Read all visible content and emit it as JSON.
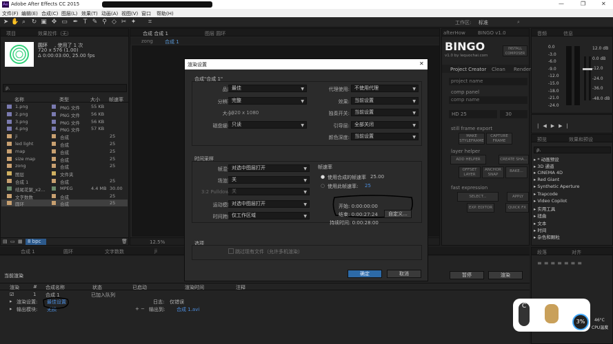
{
  "titlebar": {
    "app_title": "Adobe After Effects CC 2015",
    "logo": "Ae"
  },
  "menu": [
    "文件(F)",
    "编辑(E)",
    "合成(C)",
    "图层(L)",
    "效果(T)",
    "动画(A)",
    "视图(V)",
    "窗口",
    "帮助(H)"
  ],
  "toolbar": {
    "workspace_label": "工作区:",
    "workspace_value": "标准"
  },
  "project": {
    "tabs": [
      "项目",
      "效果控件（无）"
    ],
    "selected_name": "圆环",
    "selected_used": ", 使用了 1 次",
    "dims": "720 x 576 (1.00)",
    "duration": "Δ 0:00:03:00, 25.00 fps",
    "search_placeholder": "ρ.",
    "headers": {
      "name": "名称",
      "type": "类型",
      "size": "大小",
      "fps": "帧速率"
    },
    "items": [
      {
        "name": "1.png",
        "type": "PNG 文件",
        "size": "55 KB",
        "fps": ""
      },
      {
        "name": "2.png",
        "type": "PNG 文件",
        "size": "56 KB",
        "fps": ""
      },
      {
        "name": "3.png",
        "type": "PNG 文件",
        "size": "56 KB",
        "fps": ""
      },
      {
        "name": "4.png",
        "type": "PNG 文件",
        "size": "57 KB",
        "fps": ""
      },
      {
        "name": "ji",
        "type": "合成",
        "size": "",
        "fps": "25"
      },
      {
        "name": "led light",
        "type": "合成",
        "size": "",
        "fps": "25"
      },
      {
        "name": "map",
        "type": "合成",
        "size": "",
        "fps": "25"
      },
      {
        "name": "size map",
        "type": "合成",
        "size": "",
        "fps": "25"
      },
      {
        "name": "zong",
        "type": "合成",
        "size": "",
        "fps": "25"
      },
      {
        "name": "图层",
        "type": "文件夹",
        "size": "",
        "fps": ""
      },
      {
        "name": "合成 1",
        "type": "合成",
        "size": "",
        "fps": "25"
      },
      {
        "name": "结尾花絮_x2...",
        "type": "MPEG",
        "size": "4.4 MB",
        "fps": "30.00"
      },
      {
        "name": "文字数数",
        "type": "合成",
        "size": "",
        "fps": "25"
      },
      {
        "name": "圆环",
        "type": "合成",
        "size": "",
        "fps": "25"
      }
    ],
    "bpc": "8 bpc"
  },
  "comp": {
    "tabs": [
      "合成 合成 1",
      "图层 圆环"
    ],
    "crumbs": [
      "zong",
      "合成 1"
    ],
    "zoom": "12.5%"
  },
  "dialog": {
    "title": "渲染设置",
    "comp_label": "合成\"合成 1\"",
    "left": [
      {
        "label": "品质:",
        "value": "最佳"
      },
      {
        "label": "分辨率:",
        "value": "完整"
      },
      {
        "label": "大小:",
        "value": "1920 x 1080"
      },
      {
        "label": "磁盘缓存:",
        "value": "只读"
      }
    ],
    "right": [
      {
        "label": "代理使用:",
        "value": "不使用代理"
      },
      {
        "label": "效果:",
        "value": "当前设置"
      },
      {
        "label": "独奏开关:",
        "value": "当前设置"
      },
      {
        "label": "引导层:",
        "value": "全部关闭"
      },
      {
        "label": "颜色深度:",
        "value": "当前设置"
      }
    ],
    "time_title": "时间采样",
    "time": [
      {
        "label": "帧混合:",
        "value": "对选中图层打开"
      },
      {
        "label": "场渲染:",
        "value": "关"
      },
      {
        "label": "3:2 Pulldown:",
        "value": "关"
      },
      {
        "label": "运动模糊:",
        "value": "对选中图层打开"
      },
      {
        "label": "时间跨度:",
        "value": "仅工作区域"
      }
    ],
    "framerate_title": "帧速率",
    "fr_comp": "使用合成的帧速率",
    "fr_comp_value": "25.00",
    "fr_this": "使用此帧速率:",
    "fr_this_value": "25",
    "start": "开始: 0:00:00:00",
    "end": "结束: 0:00:27:24",
    "custom": "自定义...",
    "duration": "持续时间: 0:00:28:00",
    "options_title": "选项",
    "skip_label": "跳过现有文件（允许多机渲染）",
    "ok": "确定",
    "cancel": "取消"
  },
  "bingo": {
    "tab1": "afterHow",
    "tab2": "BINGO v1.0",
    "title": "BINGO",
    "version": "v1.0 by lequochai.com",
    "install": "INSTALL COMPOSER",
    "subtabs": [
      "Project Creator",
      "Clean",
      "Render"
    ],
    "project_name": "project name",
    "comp_panel": "comp panel",
    "comp_name": "comp name",
    "hd": "HD 25",
    "dur": "30",
    "sf_export": "still frame export",
    "make": "MAKE STYLEFRAME",
    "capture": "CAPTURE FRAME",
    "layer_helper": "layer helper",
    "add_helper": "ADD HELPER",
    "create_shape": "CREATE SHA...",
    "offset": "OFFSET LAYER",
    "anchor": "ANCHOR SNAP",
    "bake": "BAKE...",
    "fast_expr": "fast expression",
    "select": "SELECT...",
    "apply": "APPLY",
    "exp_editor": "EXP. EDITOR",
    "quick": "QUICK FX"
  },
  "audio": {
    "tabs": [
      "音频",
      "信息"
    ],
    "db_left": [
      "0.0",
      "-3.0",
      "-6.0",
      "-9.0",
      "-12.0",
      "-15.0",
      "-18.0",
      "-21.0",
      "-24.0"
    ],
    "db_right": [
      "12.0 dB",
      "0.0 dB",
      "-12.0",
      "-24.0",
      "-36.0",
      "-48.0 dB"
    ]
  },
  "preview": {
    "tabs": [
      "预览",
      "效果和预设"
    ]
  },
  "effects": {
    "search": "ρ.",
    "items": [
      "* 动画预设",
      "3D 通道",
      "CINEMA 4D",
      "Red Giant",
      "Synthetic Aperture",
      "Trapcode",
      "Video Copilot",
      "实用工具",
      "扭曲",
      "文本",
      "时间",
      "杂色和颗粒"
    ]
  },
  "paragraph": {
    "tabs": [
      "段落",
      "对齐"
    ]
  },
  "timeline": {
    "tabs": [
      "合成 1",
      "圆环",
      "文字数数",
      "ji"
    ]
  },
  "render_queue": {
    "title": "当前渲染",
    "headers": [
      "渲染",
      "#",
      "合成名称",
      "状态",
      "已启动",
      "渲染时间",
      "注释"
    ],
    "row_num": "1",
    "row_name": "合成 1",
    "row_status": "已加入队列",
    "settings_label": "渲染设置:",
    "settings_value": "最佳设置",
    "module_label": "输出模块:",
    "module_value": "无损",
    "log_label": "日志:",
    "log_value": "仅错误",
    "output_label": "输出到:",
    "output_value": "合成 1.avi",
    "pause": "暂停",
    "render_btn": "渲染"
  },
  "overlay": {
    "cpu_temp": "46°C",
    "cpu_label": "CPU温度",
    "percent": "3%"
  }
}
